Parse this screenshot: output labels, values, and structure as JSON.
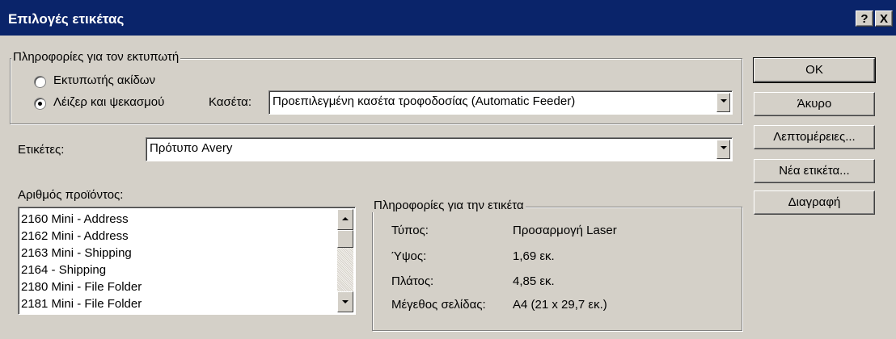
{
  "window": {
    "title": "Επιλογές ετικέτας",
    "help_button": "?",
    "close_button": "X"
  },
  "printer_info": {
    "group_label": "Πληροφορίες για τον εκτυπωτή",
    "radio_dot_matrix": "Εκτυπωτής ακίδων",
    "radio_laser": "Λέιζερ και ψεκασμού",
    "selected": "Λέιζερ και ψεκασμού",
    "tray_label": "Κασέτα:",
    "tray_value": "Προεπιλεγμένη κασέτα τροφοδοσίας (Automatic Feeder)"
  },
  "labels": {
    "label": "Ετικέτες:",
    "value": "Πρότυπο Avery"
  },
  "product": {
    "label": "Αριθμός προϊόντος:",
    "items": [
      "2160 Mini - Address",
      "2162 Mini - Address",
      "2163 Mini - Shipping",
      "2164 - Shipping",
      "2180 Mini - File Folder",
      "2181 Mini - File Folder"
    ]
  },
  "label_info": {
    "group_label": "Πληροφορίες για την ετικέτα",
    "type_label": "Τύπος:",
    "type_value": "Προσαρμογή Laser",
    "height_label": "Ύψος:",
    "height_value": "1,69 εκ.",
    "width_label": "Πλάτος:",
    "width_value": "4,85 εκ.",
    "page_size_label": "Μέγεθος σελίδας:",
    "page_size_value": "A4 (21 x 29,7 εκ.)"
  },
  "buttons": {
    "ok": "OK",
    "cancel": "Άκυρο",
    "details": "Λεπτομέρειες...",
    "new_label": "Νέα ετικέτα...",
    "delete": "Διαγραφή"
  }
}
